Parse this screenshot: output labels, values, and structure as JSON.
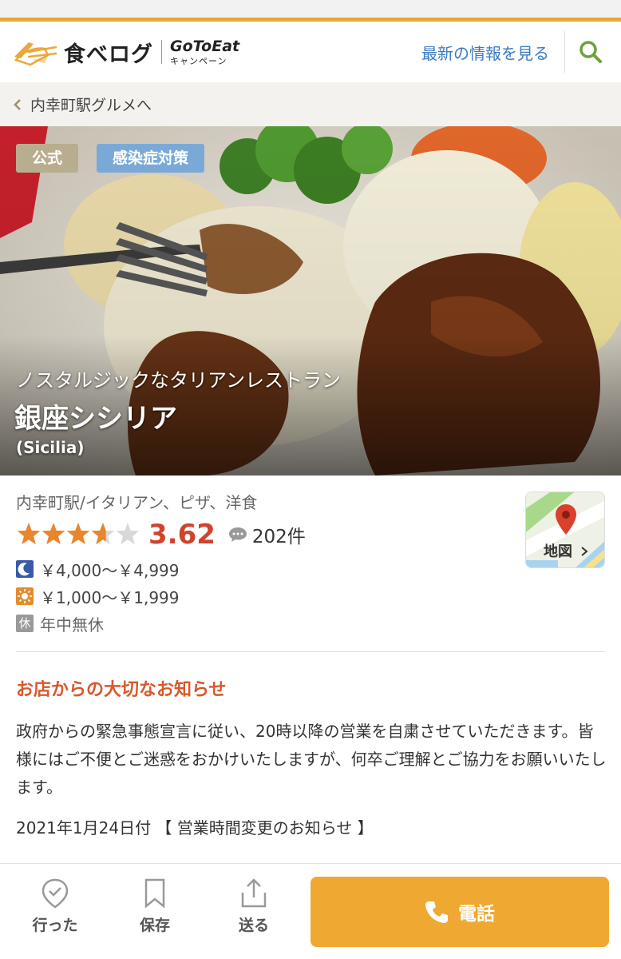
{
  "header": {
    "logo_text": "食べログ",
    "campaign_top": "GoToEat",
    "campaign_bottom": "キャンペーン",
    "news_link": "最新の情報を見る"
  },
  "breadcrumb": {
    "label": "内幸町駅グルメへ"
  },
  "hero": {
    "badges": [
      "公式",
      "感染症対策"
    ],
    "subtitle": "ノスタルジックなタリアンレストラン",
    "name": "銀座シシリア",
    "name_en": "(Sicilia)"
  },
  "info": {
    "genre": "内幸町駅/イタリアン、ピザ、洋食",
    "rating": 3.62,
    "rating_label": "3.62",
    "review_count": "202件",
    "dinner_price": "￥4,000～￥4,999",
    "lunch_price": "￥1,000～￥1,999",
    "holiday_icon": "休",
    "holiday": "年中無休",
    "map_label": "地図"
  },
  "notice": {
    "title": "お店からの大切なお知らせ",
    "body": "政府からの緊急事態宣言に従い、20時以降の営業を自粛させていただきます。皆様にはご不便とご迷惑をおかけいたしますが、何卒ご理解とご協力をお願いいたします。",
    "date_line": "2021年1月24日付 【 営業時間変更のお知らせ 】"
  },
  "bottom_bar": {
    "went": "行った",
    "save": "保存",
    "send": "送る",
    "call": "電話"
  },
  "colors": {
    "accent_orange": "#efa832",
    "score_red": "#d0442c",
    "notice_red": "#d9582c",
    "link_blue": "#3b7ac2",
    "search_green": "#6aa23a"
  },
  "icons": [
    "tabelog-logo-icon",
    "search-icon",
    "chevron-left-icon",
    "star-icon",
    "speech-bubble-icon",
    "moon-icon",
    "sun-icon",
    "map-pin-icon",
    "chevron-right-icon",
    "check-badge-icon",
    "bookmark-icon",
    "share-icon",
    "phone-icon"
  ]
}
